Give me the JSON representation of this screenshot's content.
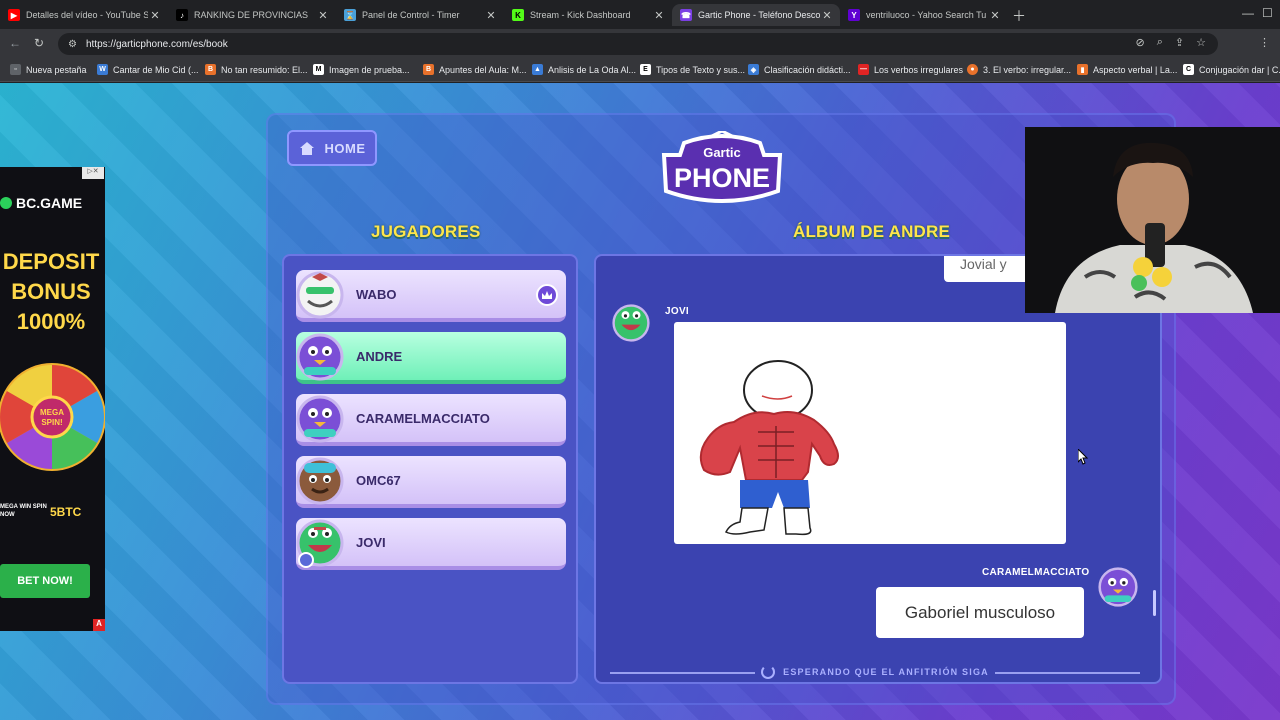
{
  "browser": {
    "tabs": [
      {
        "title": "Detalles del vídeo - YouTube St",
        "favicon": "youtube-icon",
        "color": "#ff0000"
      },
      {
        "title": "RANKING DE PROVINCIAS",
        "favicon": "tiktok-icon",
        "color": "#000000"
      },
      {
        "title": "Panel de Control - Timer",
        "favicon": "timer-icon",
        "color": "#4aa0d8"
      },
      {
        "title": "Stream - Kick Dashboard",
        "favicon": "kick-icon",
        "color": "#53fc18"
      },
      {
        "title": "Gartic Phone - Teléfono Descon",
        "favicon": "gartic-icon",
        "color": "#7b3fe4"
      },
      {
        "title": "ventriluoco - Yahoo Search Tu",
        "favicon": "yahoo-icon",
        "color": "#6001d2"
      }
    ],
    "url": "https://garticphone.com/es/book",
    "bookmarks": [
      {
        "label": "Nueva pestaña",
        "color": "#5f6368"
      },
      {
        "label": "Cantar de Mio Cid (...",
        "color": "#3a7bd5"
      },
      {
        "label": "No tan resumido: El...",
        "color": "#e8712b"
      },
      {
        "label": "Imagen de prueba...",
        "color": "#ffffff"
      },
      {
        "label": "Apuntes del Aula: M...",
        "color": "#e8712b"
      },
      {
        "label": "Anlisis de La Oda Al...",
        "color": "#3a7bd5"
      },
      {
        "label": "Tipos de Texto y sus...",
        "color": "#ffffff"
      },
      {
        "label": "Clasificación didácti...",
        "color": "#3a7bd5"
      },
      {
        "label": "Los verbos irregulares",
        "color": "#e02424"
      },
      {
        "label": "3. El verbo: irregular...",
        "color": "#e8712b"
      },
      {
        "label": "Aspecto verbal | La...",
        "color": "#e8712b"
      },
      {
        "label": "Conjugación dar | C...",
        "color": "#ffffff"
      }
    ]
  },
  "game": {
    "home_label": "HOME",
    "logo_top": "Gartic",
    "logo_main": "PHONE",
    "players_title": "JUGADORES",
    "album_title": "ÁLBUM DE ANDRE",
    "players": [
      {
        "name": "WABO",
        "avatar_color": "#f2f2f2",
        "host": true
      },
      {
        "name": "ANDRE",
        "avatar_color": "#7b4fd6",
        "highlight": true
      },
      {
        "name": "CARAMELMACCIATO",
        "avatar_color": "#7b4fd6"
      },
      {
        "name": "OMC67",
        "avatar_color": "#8b5a3c"
      },
      {
        "name": "JOVI",
        "avatar_color": "#37c26b",
        "you": true
      }
    ],
    "album": {
      "previous_text": "Jovial y",
      "drawing_author": "JOVI",
      "guess_author": "CARAMELMACCIATO",
      "guess_text": "Gaboriel musculoso",
      "waiting_text": "ESPERANDO QUE EL ANFITRIÓN SIGA"
    }
  },
  "ad": {
    "brand": "BC.GAME",
    "headline": [
      "DEPOSIT",
      "BONUS",
      "1000%"
    ],
    "wheel_center": [
      "MEGA",
      "SPIN!"
    ],
    "promo": "MEGA WIN SPIN NOW",
    "coin": "5BTC",
    "cta": "BET NOW!",
    "colors": {
      "accent": "#2bb04a",
      "headline": "#ffd84a"
    }
  },
  "colors": {
    "title_yellow": "#ffe54a",
    "highlight_green": "#6ff0b8",
    "player_card": "#e0d2fb"
  }
}
